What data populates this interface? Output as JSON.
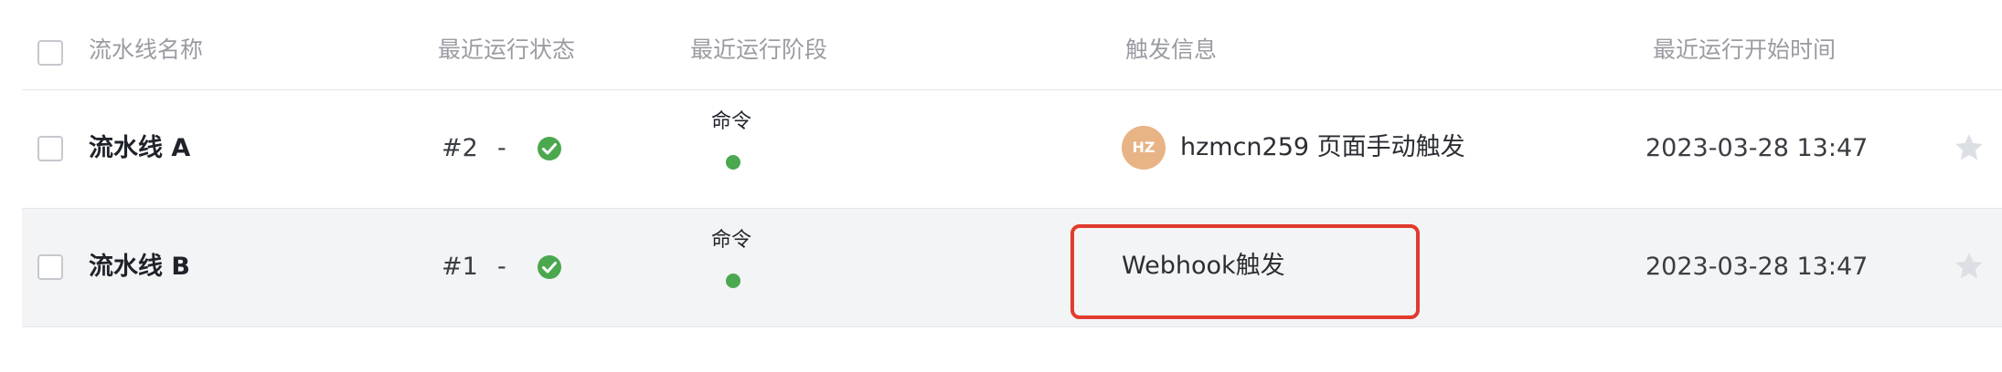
{
  "table": {
    "columns": {
      "name": "流水线名称",
      "status": "最近运行状态",
      "stage": "最近运行阶段",
      "trigger": "触发信息",
      "start_time": "最近运行开始时间"
    },
    "rows": [
      {
        "name": "流水线 A",
        "run_number": "#2",
        "separator": "-",
        "status_icon": "check-circle-icon",
        "status_color": "#4ba84f",
        "stage_label": "命令",
        "stage_dot_color": "#4ba84f",
        "avatar_initials": "HZ",
        "avatar_color": "#e8b385",
        "trigger_text": "hzmcn259 页面手动触发",
        "start_time": "2023-03-28 13:47",
        "favorite_icon": "star-icon"
      },
      {
        "name": "流水线 B",
        "run_number": "#1",
        "separator": "-",
        "status_icon": "check-circle-icon",
        "status_color": "#4ba84f",
        "stage_label": "命令",
        "stage_dot_color": "#4ba84f",
        "trigger_text": "Webhook触发",
        "start_time": "2023-03-28 13:47",
        "favorite_icon": "star-icon"
      }
    ]
  },
  "annotation": {
    "highlight_color": "#e03b2d"
  }
}
